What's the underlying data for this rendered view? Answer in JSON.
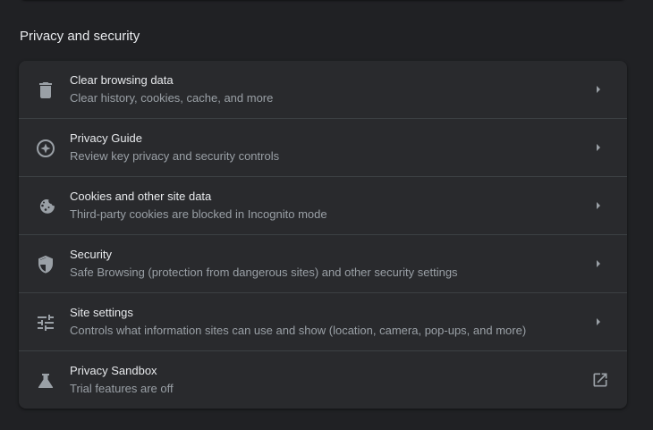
{
  "section": {
    "title": "Privacy and security"
  },
  "items": [
    {
      "label": "Clear browsing data",
      "sublabel": "Clear history, cookies, cache, and more",
      "icon": "trash-icon",
      "action": "chevron-right-icon"
    },
    {
      "label": "Privacy Guide",
      "sublabel": "Review key privacy and security controls",
      "icon": "compass-icon",
      "action": "chevron-right-icon"
    },
    {
      "label": "Cookies and other site data",
      "sublabel": "Third-party cookies are blocked in Incognito mode",
      "icon": "cookie-icon",
      "action": "chevron-right-icon"
    },
    {
      "label": "Security",
      "sublabel": "Safe Browsing (protection from dangerous sites) and other security settings",
      "icon": "shield-icon",
      "action": "chevron-right-icon"
    },
    {
      "label": "Site settings",
      "sublabel": "Controls what information sites can use and show (location, camera, pop-ups, and more)",
      "icon": "tune-icon",
      "action": "chevron-right-icon"
    },
    {
      "label": "Privacy Sandbox",
      "sublabel": "Trial features are off",
      "icon": "flask-icon",
      "action": "open-in-new-icon"
    }
  ],
  "colors": {
    "background": "#202124",
    "card": "#292a2d",
    "divider": "#3c4043",
    "text_primary": "#e8eaed",
    "text_secondary": "#9aa0a6",
    "icon": "#9aa0a6"
  }
}
